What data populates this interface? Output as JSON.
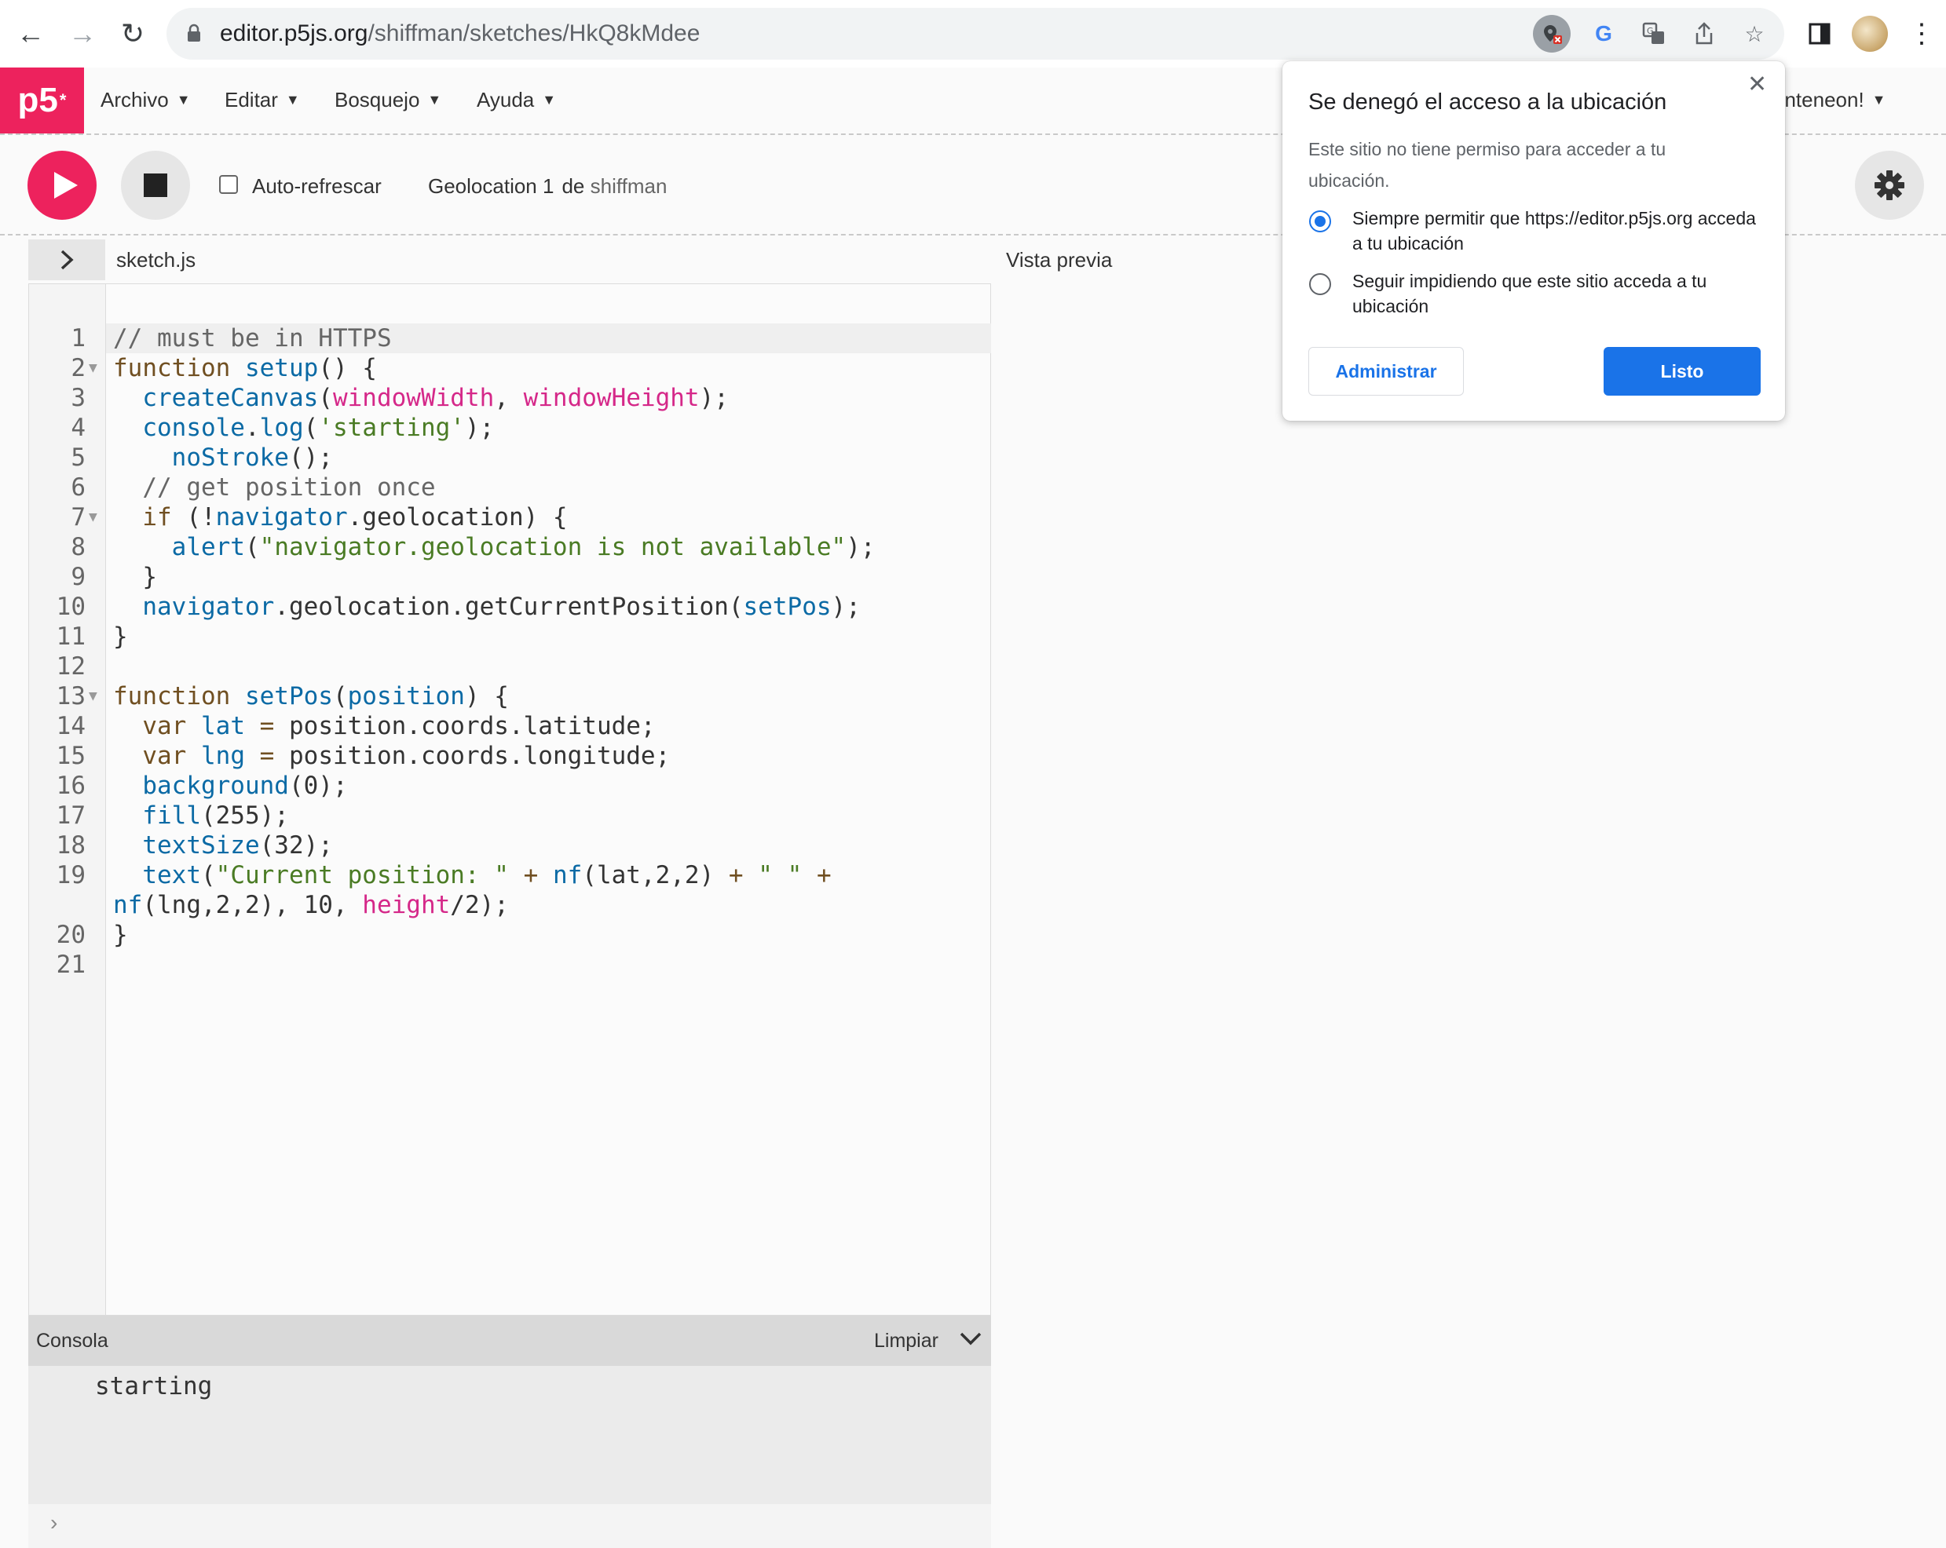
{
  "browser": {
    "url_host": "editor.p5js.org",
    "url_path": "/shiffman/sketches/HkQ8kMdee",
    "icons": [
      "back-icon",
      "forward-icon",
      "reload-icon",
      "lock-icon",
      "location-blocked-icon",
      "google-icon",
      "translate-icon",
      "share-icon",
      "bookmark-star-icon",
      "side-panel-icon",
      "profile-avatar",
      "kebab-menu-icon"
    ]
  },
  "menubar": {
    "logo": "p5",
    "logo_sup": "*",
    "items": [
      "Archivo",
      "Editar",
      "Bosquejo",
      "Ayuda"
    ],
    "user_label": "enteneon!"
  },
  "toolbar": {
    "auto_refresh_label": "Auto-refrescar",
    "auto_refresh_checked": false,
    "sketch_name": "Geolocation 1",
    "by_label": "de",
    "author": "shiffman"
  },
  "editor": {
    "tab_name": "sketch.js",
    "preview_label": "Vista previa",
    "lines": [
      {
        "n": "1",
        "fold": false
      },
      {
        "n": "2",
        "fold": true
      },
      {
        "n": "3",
        "fold": false
      },
      {
        "n": "4",
        "fold": false
      },
      {
        "n": "5",
        "fold": false
      },
      {
        "n": "6",
        "fold": false
      },
      {
        "n": "7",
        "fold": true
      },
      {
        "n": "8",
        "fold": false
      },
      {
        "n": "9",
        "fold": false
      },
      {
        "n": "10",
        "fold": false
      },
      {
        "n": "11",
        "fold": false
      },
      {
        "n": "12",
        "fold": false
      },
      {
        "n": "13",
        "fold": true
      },
      {
        "n": "14",
        "fold": false
      },
      {
        "n": "15",
        "fold": false
      },
      {
        "n": "16",
        "fold": false
      },
      {
        "n": "17",
        "fold": false
      },
      {
        "n": "18",
        "fold": false
      },
      {
        "n": "19",
        "fold": false
      },
      {
        "n": "20",
        "fold": false
      },
      {
        "n": "21",
        "fold": false
      }
    ]
  },
  "code_tokens": {
    "l1": [
      "// must be in HTTPS"
    ],
    "l2": [
      "function",
      " ",
      "setup",
      "() {"
    ],
    "l3": [
      "  ",
      "createCanvas",
      "(",
      "windowWidth",
      ", ",
      "windowHeight",
      ");"
    ],
    "l4": [
      "  ",
      "console",
      ".",
      "log",
      "(",
      "'starting'",
      ");"
    ],
    "l5": [
      "    ",
      "noStroke",
      "();"
    ],
    "l6": [
      "  ",
      "// get position once"
    ],
    "l7": [
      "  ",
      "if",
      " (!",
      "navigator",
      ".geolocation) {"
    ],
    "l8": [
      "    ",
      "alert",
      "(",
      "\"navigator.geolocation is not available\"",
      ");"
    ],
    "l9": [
      "  }"
    ],
    "l10": [
      "  ",
      "navigator",
      ".geolocation.getCurrentPosition(",
      "setPos",
      ");"
    ],
    "l11": [
      "}"
    ],
    "l12": [
      ""
    ],
    "l13": [
      "function",
      " ",
      "setPos",
      "(",
      "position",
      ") {"
    ],
    "l14": [
      "  ",
      "var",
      " ",
      "lat",
      " ",
      "=",
      " position.coords.latitude;"
    ],
    "l15": [
      "  ",
      "var",
      " ",
      "lng",
      " ",
      "=",
      " position.coords.longitude;"
    ],
    "l16": [
      "  ",
      "background",
      "(0);"
    ],
    "l17": [
      "  ",
      "fill",
      "(255);"
    ],
    "l18": [
      "  ",
      "textSize",
      "(32);"
    ],
    "l19": [
      "  ",
      "text",
      "(",
      "\"Current position: \"",
      " ",
      "+",
      " ",
      "nf",
      "(lat,2,2) ",
      "+",
      " ",
      "\" \"",
      " ",
      "+",
      " ",
      "nf",
      "(lng,2,2), 10, ",
      "height",
      "/2);"
    ],
    "l20": [
      "}"
    ],
    "l21": [
      ""
    ]
  },
  "console": {
    "title": "Consola",
    "clear_label": "Limpiar",
    "output": "starting",
    "prompt": "›"
  },
  "popup": {
    "title": "Se denegó el acceso a la ubicación",
    "description": "Este sitio no tiene permiso para acceder a tu ubicación.",
    "option_allow": "Siempre permitir que https://editor.p5js.org acceda a tu ubicación",
    "option_block": "Seguir impidiendo que este sitio acceda a tu ubicación",
    "selected_option": "option_allow",
    "manage_label": "Administrar",
    "done_label": "Listo"
  },
  "colors": {
    "p5_pink": "#ed225d",
    "chrome_blue": "#1a73e8"
  }
}
